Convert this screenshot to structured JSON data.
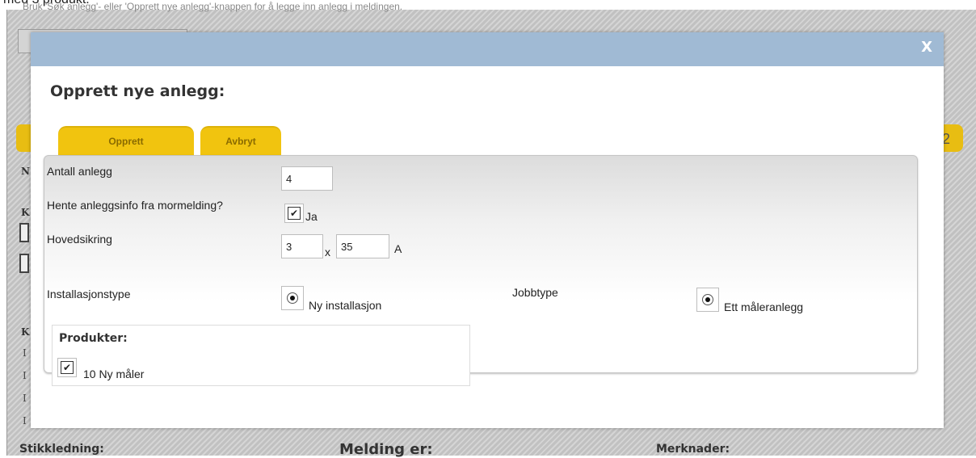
{
  "page": {
    "top_cut_text": "med 3 produkt.",
    "hint_text": "Bruk 'Søk anlegg'- eller 'Opprett nye anlegg'-knappen for å legge inn anlegg i meldingen.",
    "bg_letters": [
      "N",
      "K",
      "K"
    ],
    "bg_i": [
      "I",
      "I",
      "I",
      "I"
    ],
    "bg_tab_right": "2",
    "bottom_labels": [
      "Stikkledning:",
      "Melding er:",
      "Merknader:"
    ]
  },
  "dialog": {
    "close_label": "X",
    "title": "Opprett nye anlegg:",
    "tabs": [
      {
        "label": "Opprett"
      },
      {
        "label": "Avbryt"
      }
    ],
    "form": {
      "antall_label": "Antall anlegg",
      "antall_value": "4",
      "hente_label": "Hente anleggsinfo fra mormelding?",
      "hente_checked": true,
      "hente_option": "Ja",
      "hovedsikring_label": "Hovedsikring",
      "hovedsikring_value1": "3",
      "hovedsikring_x": "x",
      "hovedsikring_value2": "35",
      "hovedsikring_unit": "A",
      "installasjonstype_label": "Installasjonstype",
      "installasjonstype_option": "Ny installasjon",
      "installasjonstype_selected": true,
      "jobbtype_label": "Jobbtype",
      "jobbtype_option": "Ett måleranlegg",
      "jobbtype_selected": true
    },
    "produkter": {
      "title": "Produkter:",
      "items": [
        {
          "label": "10 Ny måler",
          "checked": true
        }
      ]
    }
  }
}
